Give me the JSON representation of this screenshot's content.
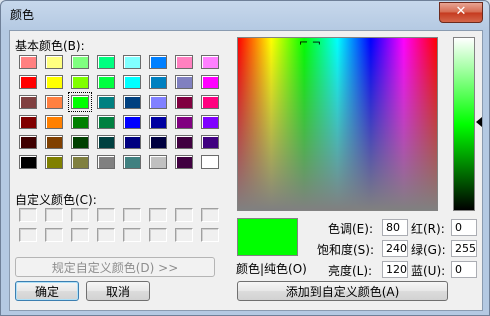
{
  "window": {
    "title": "颜色",
    "close_symbol": "✕"
  },
  "basic": {
    "label": "基本颜色(B):",
    "selected_index": 18,
    "colors": [
      "#ff8080",
      "#ffff80",
      "#80ff80",
      "#00ff80",
      "#80ffff",
      "#0080ff",
      "#ff80c0",
      "#ff80ff",
      "#ff0000",
      "#ffff00",
      "#80ff00",
      "#00ff40",
      "#00ffff",
      "#0080c0",
      "#8080c0",
      "#ff00ff",
      "#804040",
      "#ff8040",
      "#00ff00",
      "#008080",
      "#004080",
      "#8080ff",
      "#800040",
      "#ff0080",
      "#800000",
      "#ff8000",
      "#008000",
      "#008040",
      "#0000ff",
      "#0000a0",
      "#800080",
      "#8000ff",
      "#400000",
      "#804000",
      "#004000",
      "#004040",
      "#000080",
      "#000040",
      "#400040",
      "#400080",
      "#000000",
      "#808000",
      "#808040",
      "#808080",
      "#408080",
      "#c0c0c0",
      "#400040",
      "#ffffff"
    ]
  },
  "custom": {
    "label": "自定义颜色(C):",
    "count": 16
  },
  "buttons": {
    "define_custom": "规定自定义颜色(D) >>",
    "ok": "确定",
    "cancel": "取消",
    "add_custom": "添加到自定义颜色(A)"
  },
  "color_solid_label": "颜色|纯色(O)",
  "current_color": "#00ff00",
  "hsl": {
    "hue_label": "色调(E):",
    "hue": "80",
    "sat_label": "饱和度(S):",
    "sat": "240",
    "lum_label": "亮度(L):",
    "lum": "120"
  },
  "rgb": {
    "red_label": "红(R):",
    "red": "0",
    "green_label": "绿(G):",
    "green": "255",
    "blue_label": "蓝(U):",
    "blue": "0"
  },
  "icons": {
    "close": "close-icon",
    "crosshair": "crosshair-icon",
    "luminance_arrow": "arrow-left-icon"
  }
}
